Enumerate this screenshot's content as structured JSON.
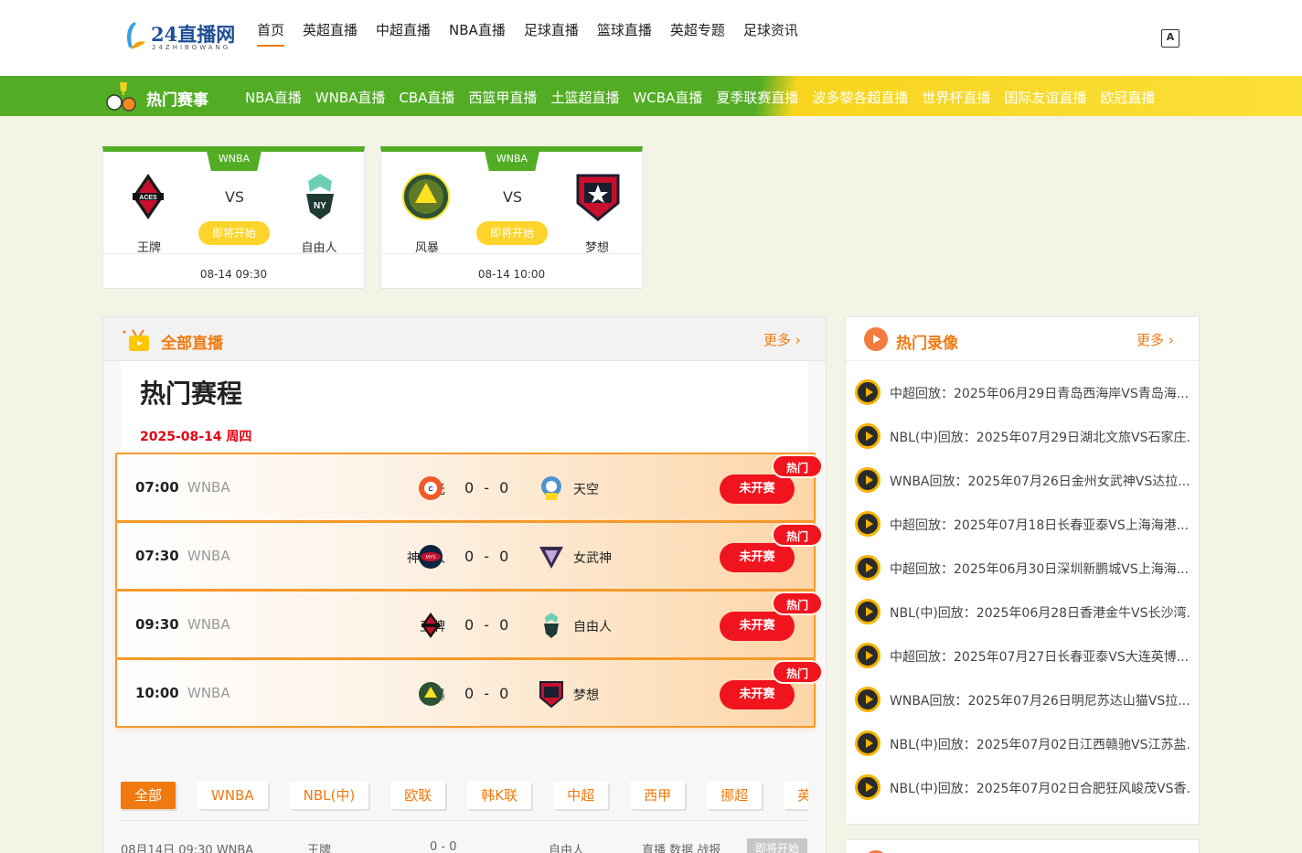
{
  "header": {
    "logo_main": "24直播网",
    "logo_sub": "24ZHIBOWANG",
    "nav": [
      "首页",
      "英超直播",
      "中超直播",
      "NBA直播",
      "足球直播",
      "篮球直播",
      "英超专题",
      "足球资讯"
    ],
    "lang_icon": "A"
  },
  "hotbar": {
    "title": "热门赛事",
    "links": [
      "NBA直播",
      "WNBA直播",
      "CBA直播",
      "西篮甲直播",
      "土篮超直播",
      "WCBA直播",
      "夏季联赛直播",
      "波多黎各超直播",
      "世界杯直播",
      "国际友谊直播",
      "欧冠直播"
    ]
  },
  "cards": [
    {
      "league": "WNBA",
      "vs": "VS",
      "home": "王牌",
      "away": "自由人",
      "status": "即将开始",
      "time": "08-14 09:30"
    },
    {
      "league": "WNBA",
      "vs": "VS",
      "home": "风暴",
      "away": "梦想",
      "status": "即将开始",
      "time": "08-14 10:00"
    }
  ],
  "live": {
    "title": "全部直播",
    "more": "更多",
    "heading": "热门赛程",
    "date": "2025-08-14 周四",
    "matches": [
      {
        "time": "07:00",
        "league": "WNBA",
        "home": "阳光",
        "score": "0 - 0",
        "away": "天空",
        "status": "未开赛",
        "badge": "热门"
      },
      {
        "time": "07:30",
        "league": "WNBA",
        "home": "神秘人",
        "score": "0 - 0",
        "away": "女武神",
        "status": "未开赛",
        "badge": "热门"
      },
      {
        "time": "09:30",
        "league": "WNBA",
        "home": "王牌",
        "score": "0 - 0",
        "away": "自由人",
        "status": "未开赛",
        "badge": "热门"
      },
      {
        "time": "10:00",
        "league": "WNBA",
        "home": "风暴",
        "score": "0 - 0",
        "away": "梦想",
        "status": "未开赛",
        "badge": "热门"
      }
    ],
    "filters": [
      "全部",
      "WNBA",
      "NBL(中)",
      "欧联",
      "韩K联",
      "中超",
      "西甲",
      "挪超",
      "英超"
    ],
    "list_row": {
      "text": "08月14日 09:30 WNBA",
      "home": "王牌",
      "score": "0 - 0",
      "away": "自由人",
      "links": "直播  数据  战报",
      "btn": "即将开始"
    }
  },
  "replays": {
    "title": "热门录像",
    "more": "更多",
    "items": [
      "中超回放：2025年06月29日青岛西海岸VS青岛海...",
      "NBL(中)回放：2025年07月29日湖北文旅VS石家庄...",
      "WNBA回放：2025年07月26日金州女武神VS达拉...",
      "中超回放：2025年07月18日长春亚泰VS上海海港...",
      "中超回放：2025年06月30日深圳新鹏城VS上海海...",
      "NBL(中)回放：2025年06月28日香港金牛VS长沙湾...",
      "中超回放：2025年07月27日长春亚泰VS大连英博...",
      "WNBA回放：2025年07月26日明尼苏达山猫VS拉...",
      "NBL(中)回放：2025年07月02日江西赣驰VS江苏盐...",
      "NBL(中)回放：2025年07月02日合肥狂风峻茂VS香..."
    ]
  },
  "colors": {
    "accent": "#f07a10",
    "green": "#52ad25",
    "red": "#f0141e",
    "yellow": "#fcd42c"
  }
}
